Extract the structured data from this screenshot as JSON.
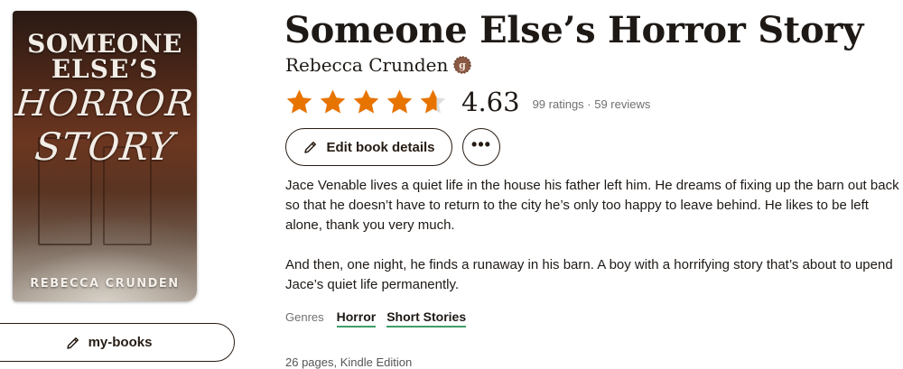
{
  "book": {
    "title": "Someone Else’s Horror Story",
    "author": "Rebecca Crunden",
    "author_badge_icon": "goodreads-author-badge-icon",
    "average_rating": "4.63",
    "rating_fraction": 0.926,
    "stars": 4.63,
    "ratings_meta": "99 ratings · 59 reviews",
    "description": [
      "Jace Venable lives a quiet life in the house his father left him. He dreams of fixing up the barn out back so that he doesn’t have to return to the city he’s only too happy to leave behind. He likes to be left alone, thank you very much.",
      "And then, one night, he finds a runaway in his barn. A boy with a horrifying story that’s about to upend Jace’s quiet life permanently."
    ],
    "genres_label": "Genres",
    "genres": [
      "Horror",
      "Short Stories"
    ],
    "pages_info": "26 pages, Kindle Edition"
  },
  "cover": {
    "line1": "SOMEONE",
    "line2": "ELSE’S",
    "line3": "HORROR",
    "line4": "STORY",
    "author": "REBECCA CRUNDEN"
  },
  "actions": {
    "edit_label": "Edit book details",
    "more_label": "•••",
    "mybooks_label": "my-books"
  },
  "colors": {
    "star_fill": "#e87400",
    "star_empty": "#dedede",
    "genre_underline": "#409d69",
    "text": "#1e1915"
  }
}
